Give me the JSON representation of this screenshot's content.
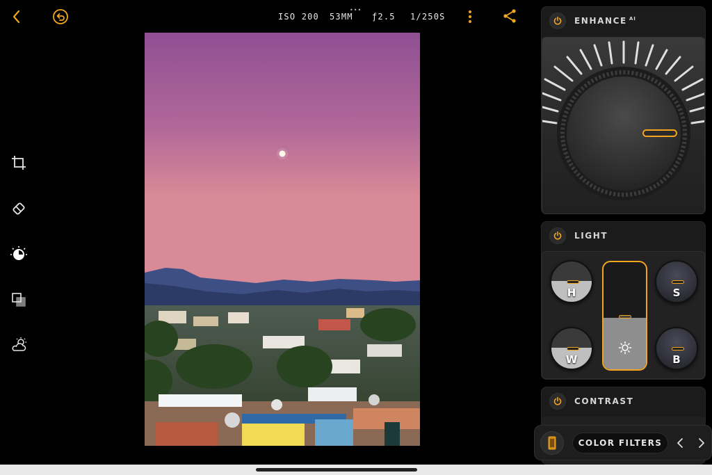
{
  "exif": {
    "iso": "ISO 200",
    "focal": "53MM",
    "aperture": "ƒ2.5",
    "shutter": "1/250S",
    "more": "•••"
  },
  "icons": {
    "top": [
      "back-icon",
      "revert-icon",
      "more-vertical-icon",
      "share-icon"
    ],
    "tools": [
      "crop-icon",
      "eraser-icon",
      "exposure-dial-icon",
      "layers-icon",
      "weather-icon"
    ]
  },
  "panels": {
    "enhance": {
      "title": "ENHANCE",
      "superscript": "AI"
    },
    "light": {
      "title": "LIGHT",
      "dials": {
        "highlights": "H",
        "shadows": "S",
        "whites": "W",
        "blacks": "B"
      }
    },
    "contrast": {
      "title": "CONTRAST"
    }
  },
  "filter_bar": {
    "label": "COLOR FILTERS"
  },
  "colors": {
    "accent": "#f2a51f",
    "panel": "#1b1b1b",
    "background": "#000000"
  }
}
